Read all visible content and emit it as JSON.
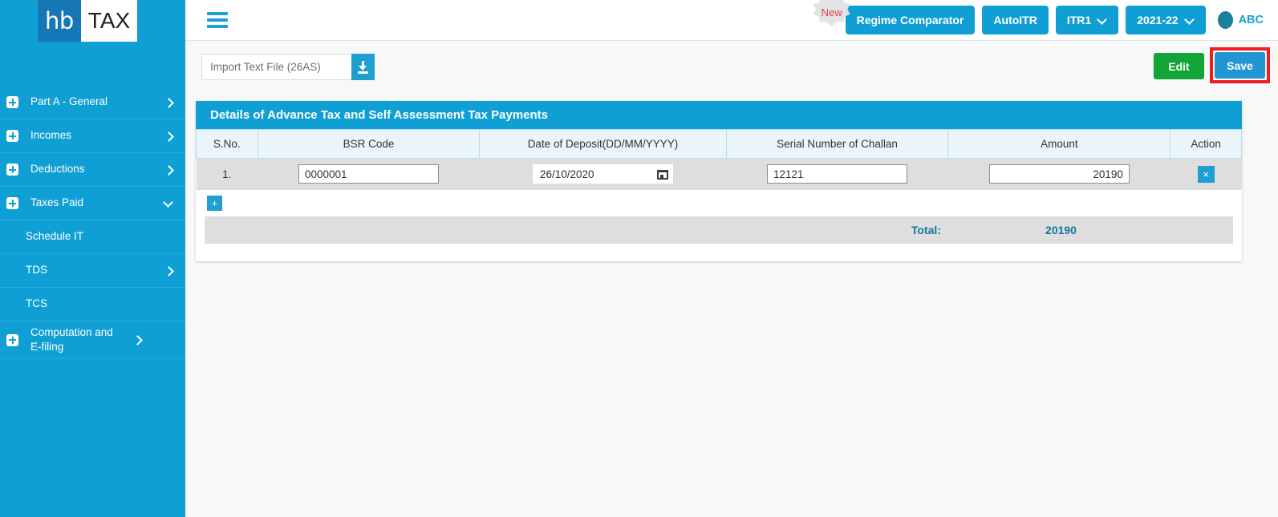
{
  "brand": {
    "logo_primary": "hb",
    "logo_secondary": "TAX",
    "accent_blue": "#109fd4"
  },
  "sidebar": {
    "items": [
      {
        "label": "Part A - General",
        "icon": "plus-icon",
        "chevron": "chevron-right-icon",
        "expandable": true
      },
      {
        "label": "Incomes",
        "icon": "plus-icon",
        "chevron": "chevron-right-icon",
        "expandable": true
      },
      {
        "label": "Deductions",
        "icon": "plus-icon",
        "chevron": "chevron-right-icon",
        "expandable": true
      },
      {
        "label": "Taxes Paid",
        "icon": "plus-icon",
        "chevron": "chevron-down-icon",
        "expandable": true
      },
      {
        "label": "Schedule IT",
        "icon": null,
        "chevron": null,
        "expandable": false
      },
      {
        "label": "TDS",
        "icon": null,
        "chevron": "chevron-right-icon",
        "expandable": false
      },
      {
        "label": "TCS",
        "icon": null,
        "chevron": null,
        "expandable": false
      },
      {
        "label": "Computation and E-filing",
        "icon": "plus-icon",
        "chevron": "chevron-right-icon",
        "expandable": true
      }
    ]
  },
  "topbar": {
    "menu_icon": "hamburger-icon",
    "new_badge": "New",
    "regime_comparator": "Regime Comparator",
    "auto_itr": "AutoITR",
    "itr_form": "ITR1",
    "assessment_year": "2021-22",
    "user_name": "ABC"
  },
  "action_strip": {
    "import_label": "Import Text File (26AS)",
    "import_icon": "download-icon",
    "edit_label": "Edit",
    "save_label": "Save",
    "save_highlight_color": "#ee1c25"
  },
  "card": {
    "title": "Details of Advance Tax and Self Assessment Tax Payments",
    "columns": [
      "S.No.",
      "BSR Code",
      "Date of Deposit(DD/MM/YYYY)",
      "Serial Number of Challan",
      "Amount",
      "Action"
    ],
    "rows": [
      {
        "sno": "1.",
        "bsr_code": "0000001",
        "date_of_deposit": "26/10/2020",
        "serial_number": "12121",
        "amount": "20190",
        "delete_label": "×"
      }
    ],
    "add_row_label": "+",
    "total_label": "Total:",
    "total_value": "20190"
  }
}
